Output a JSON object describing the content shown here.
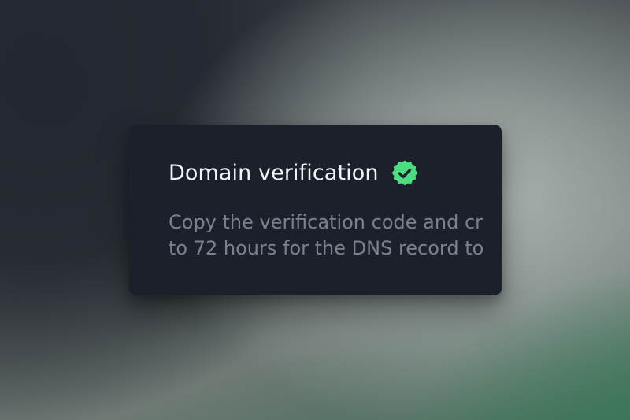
{
  "card": {
    "title": "Domain verification",
    "badge_icon": "verified-badge-icon",
    "badge_color": "#4ade80",
    "description_lines": [
      "Copy the verification code and cr",
      "to 72 hours for the DNS record to"
    ]
  }
}
